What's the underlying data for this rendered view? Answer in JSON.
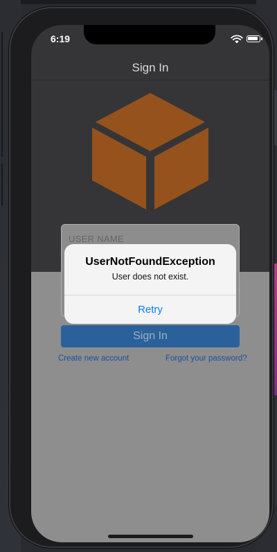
{
  "status_bar": {
    "time": "6:19"
  },
  "nav": {
    "title": "Sign In"
  },
  "form": {
    "username_placeholder": "USER NAME",
    "signin_label": "Sign In",
    "create_account_label": "Create new account",
    "forgot_password_label": "Forgot your password?"
  },
  "alert": {
    "title": "UserNotFoundException",
    "message": "User does not exist.",
    "button_label": "Retry"
  },
  "colors": {
    "brand_box": "#a25a1f",
    "primary_button": "#2e6aa8",
    "alert_action": "#0a7aff"
  },
  "icons": [
    "box-logo-icon",
    "wifi-icon",
    "battery-icon"
  ]
}
